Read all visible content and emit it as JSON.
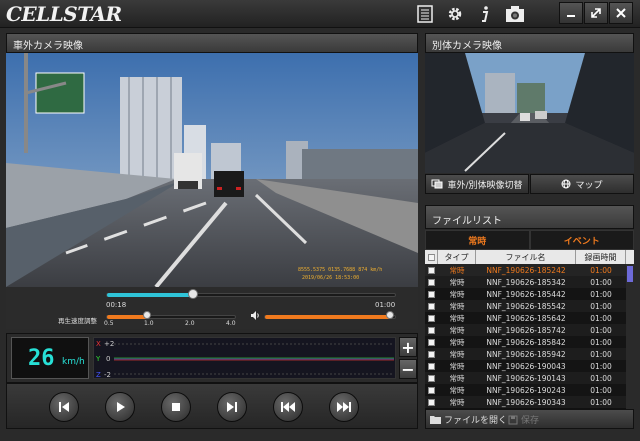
{
  "app": {
    "logo": "CELLSTAR"
  },
  "titlebar": {
    "icons": [
      "list-icon",
      "gear-icon",
      "info-icon",
      "camera-icon"
    ],
    "window_buttons": [
      "minimize-button",
      "maximize-button",
      "close-button"
    ]
  },
  "main_video": {
    "title": "車外カメラ映像",
    "overlay_lines": [
      "8555.5375  0135.7688  874 km/h",
      "2019/06/26 18:53:00"
    ]
  },
  "sub_video": {
    "title": "別体カメラ映像"
  },
  "sub_buttons": {
    "switch_label": "車外/別体映像切替",
    "map_label": "マップ"
  },
  "seek": {
    "current": "00:18",
    "total": "01:00",
    "progress": 0.3
  },
  "playback_speed": {
    "label": "再生速度調整",
    "ticks": [
      "0.5",
      "1.0",
      "2.0",
      "4.0"
    ],
    "value": 1.0
  },
  "volume": {
    "level": 1.0
  },
  "speed": {
    "value": "26",
    "unit": "km/h"
  },
  "gsensor": {
    "axes": [
      "X",
      "Y",
      "Z"
    ],
    "labels": [
      "+2",
      "0",
      "-2"
    ]
  },
  "controls": [
    "skip-start",
    "play",
    "stop",
    "step-forward",
    "prev-file",
    "next-file"
  ],
  "file_list": {
    "title": "ファイルリスト",
    "tabs": [
      "常時",
      "イベント"
    ],
    "columns": [
      "タイプ",
      "ファイル名",
      "録画時間"
    ],
    "rows": [
      {
        "type": "常時",
        "name": "NNF_190626-185242",
        "time": "01:00",
        "selected": true
      },
      {
        "type": "常時",
        "name": "NNF_190626-185342",
        "time": "01:00"
      },
      {
        "type": "常時",
        "name": "NNF_190626-185442",
        "time": "01:00"
      },
      {
        "type": "常時",
        "name": "NNF_190626-185542",
        "time": "01:00"
      },
      {
        "type": "常時",
        "name": "NNF_190626-185642",
        "time": "01:00"
      },
      {
        "type": "常時",
        "name": "NNF_190626-185742",
        "time": "01:00"
      },
      {
        "type": "常時",
        "name": "NNF_190626-185842",
        "time": "01:00"
      },
      {
        "type": "常時",
        "name": "NNF_190626-185942",
        "time": "01:00"
      },
      {
        "type": "常時",
        "name": "NNF_190626-190043",
        "time": "01:00"
      },
      {
        "type": "常時",
        "name": "NNF_190626-190143",
        "time": "01:00"
      },
      {
        "type": "常時",
        "name": "NNF_190626-190243",
        "time": "01:00"
      },
      {
        "type": "常時",
        "name": "NNF_190626-190343",
        "time": "01:00"
      }
    ],
    "open_label": "ファイルを開く",
    "save_label": "保存"
  }
}
